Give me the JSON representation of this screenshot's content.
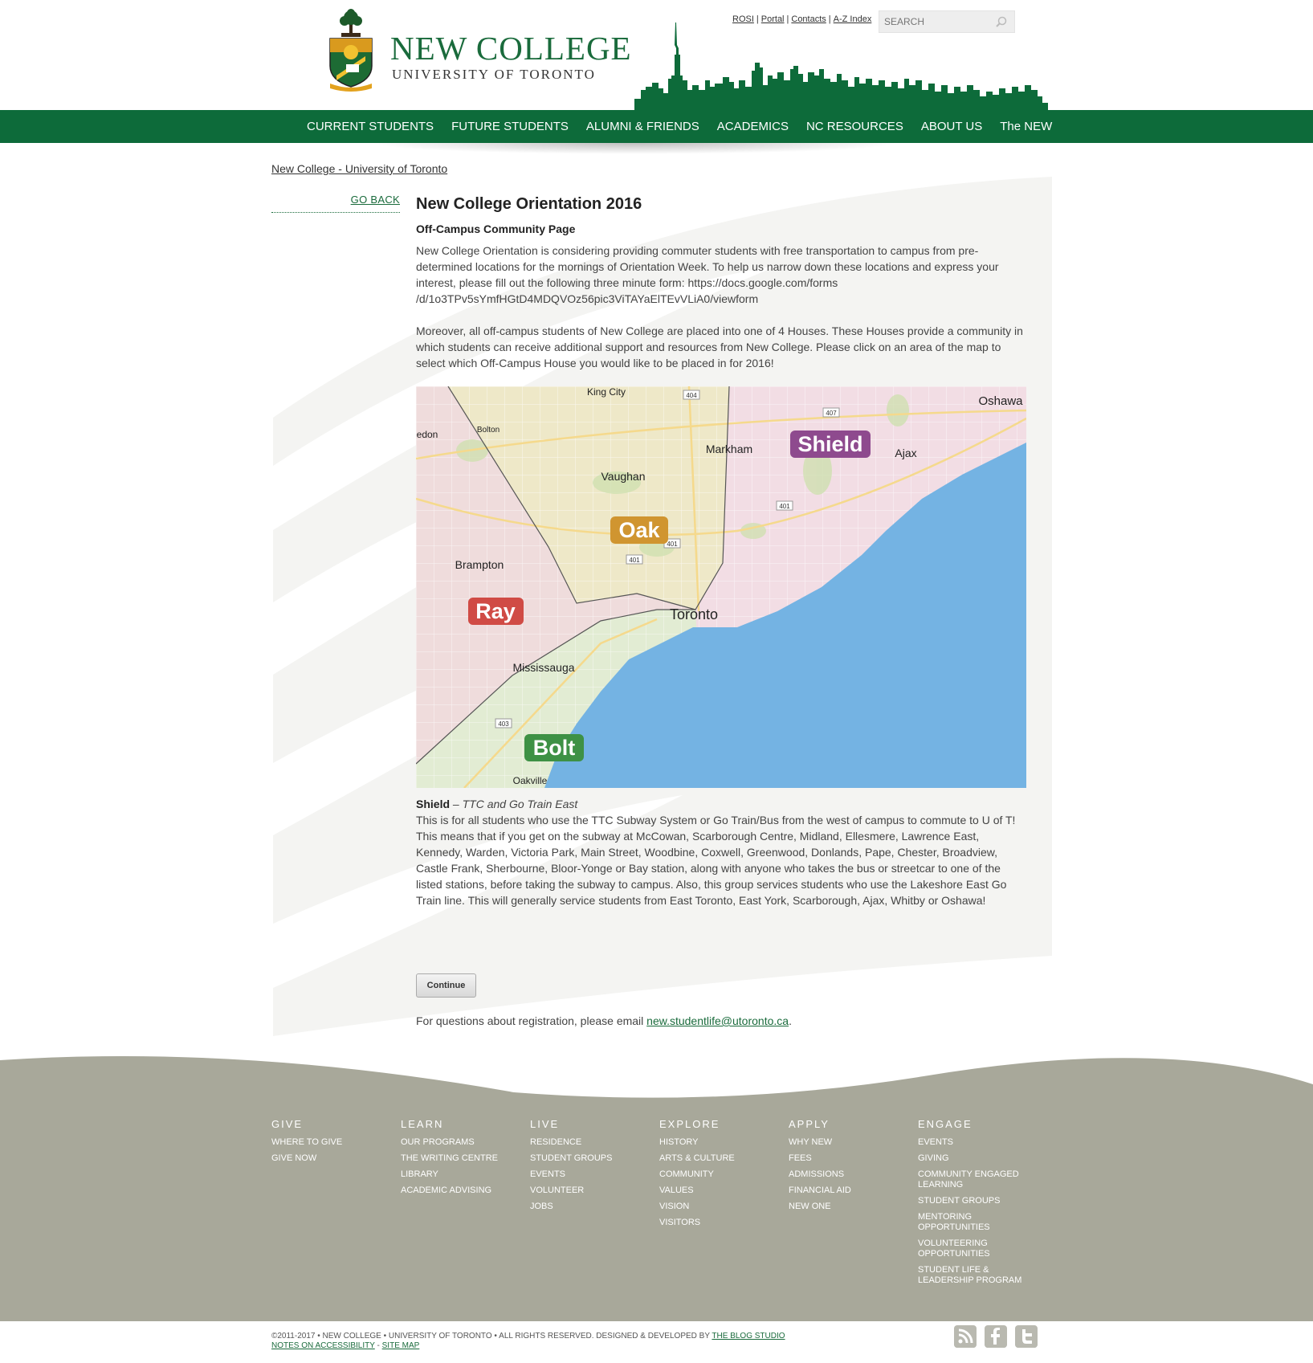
{
  "header": {
    "logo_title": "NEW COLLEGE",
    "logo_subtitle": "UNIVERSITY OF TORONTO",
    "util_links": [
      "ROSI",
      "Portal",
      "Contacts",
      "A-Z Index"
    ],
    "search_placeholder": "SEARCH"
  },
  "nav": [
    "CURRENT STUDENTS",
    "FUTURE STUDENTS",
    "ALUMNI & FRIENDS",
    "ACADEMICS",
    "NC RESOURCES",
    "ABOUT US",
    "The NEW"
  ],
  "breadcrumb": "New College - University of Toronto",
  "sidebar": {
    "go_back": "GO BACK"
  },
  "main": {
    "title": "New College Orientation 2016",
    "subtitle": "Off-Campus Community Page",
    "para1": "New College Orientation is considering providing commuter students with free transportation to campus from pre-determined locations for the mornings of Orientation Week. To help us narrow down these locations and express your interest, please fill out the following three minute form: https://docs.google.com/forms /d/1o3TPv5sYmfHGtD4MDQVOz56pic3ViTAYaElTEvVLiA0/viewform",
    "para2": "Moreover, all off-campus students of New College are placed into one of 4 Houses. These Houses provide a community in which students can receive additional support and resources from New College. Please click on an area of the map to select which Off-Campus House you would like to be placed in for 2016!"
  },
  "map": {
    "cities": [
      "King City",
      "Bolton",
      "Markham",
      "Vaughan",
      "Ajax",
      "Oshawa",
      "Brampton",
      "Toronto",
      "Mississauga",
      "Oakville",
      "edon"
    ],
    "highways": [
      "404",
      "407",
      "401",
      "401",
      "401",
      "403"
    ],
    "houses": [
      {
        "name": "Shield",
        "color": "#8e4a8e"
      },
      {
        "name": "Oak",
        "color": "#d09530"
      },
      {
        "name": "Ray",
        "color": "#d04b45"
      },
      {
        "name": "Bolt",
        "color": "#3e9145"
      }
    ],
    "colors": {
      "lake": "#74b3e3",
      "region_west": "#efdcdc",
      "region_north": "#eee8c8",
      "region_east": "#f2dde4",
      "region_south": "#e2ecd3"
    }
  },
  "selected_house": {
    "name": "Shield",
    "dash": " – ",
    "tagline": "TTC and Go Train East",
    "description": "This is for all students who use the TTC Subway System or Go Train/Bus from the west of campus to commute to U of T! This means that if you get on the subway at McCowan, Scarborough Centre, Midland, Ellesmere, Lawrence East, Kennedy, Warden, Victoria Park, Main Street, Woodbine, Coxwell, Greenwood, Donlands, Pape, Chester, Broadview, Castle Frank, Sherbourne, Bloor-Yonge or Bay station, along with anyone who takes the bus or streetcar to one of the listed stations, before taking the subway to campus. Also, this group services students who use the Lakeshore East Go Train line. This will generally service students from East Toronto, East York, Scarborough, Ajax, Whitby or Oshawa!"
  },
  "continue_label": "Continue",
  "registration": {
    "text": "For questions about registration, please email ",
    "email": "new.studentlife@utoronto.ca",
    "end": "."
  },
  "footer": {
    "columns": [
      {
        "heading": "GIVE",
        "links": [
          "WHERE TO GIVE",
          "GIVE NOW"
        ]
      },
      {
        "heading": "LEARN",
        "links": [
          "OUR PROGRAMS",
          "THE WRITING CENTRE",
          "LIBRARY",
          "ACADEMIC ADVISING"
        ]
      },
      {
        "heading": "LIVE",
        "links": [
          "RESIDENCE",
          "STUDENT GROUPS",
          "EVENTS",
          "VOLUNTEER",
          "JOBS"
        ]
      },
      {
        "heading": "EXPLORE",
        "links": [
          "HISTORY",
          "ARTS & CULTURE",
          "COMMUNITY",
          "VALUES",
          "VISION",
          "VISITORS"
        ]
      },
      {
        "heading": "APPLY",
        "links": [
          "WHY NEW",
          "FEES",
          "ADMISSIONS",
          "FINANCIAL AID",
          "NEW ONE"
        ]
      },
      {
        "heading": "ENGAGE",
        "links": [
          "EVENTS",
          "GIVING",
          "COMMUNITY ENGAGED LEARNING",
          "STUDENT GROUPS",
          "MENTORING OPPORTUNITIES",
          "VOLUNTEERING OPPORTUNITIES",
          "STUDENT LIFE & LEADERSHIP PROGRAM"
        ]
      }
    ],
    "copyright": "©2011-2017 • NEW COLLEGE • UNIVERSITY OF TORONTO • ALL RIGHTS RESERVED. DESIGNED & DEVELOPED BY ",
    "studio": "THE BLOG STUDIO",
    "accessibility": "NOTES ON ACCESSIBILITY",
    "dash": " - ",
    "sitemap": "SITE MAP",
    "social_icons": [
      "rss-icon",
      "facebook-icon",
      "twitter-icon"
    ]
  }
}
